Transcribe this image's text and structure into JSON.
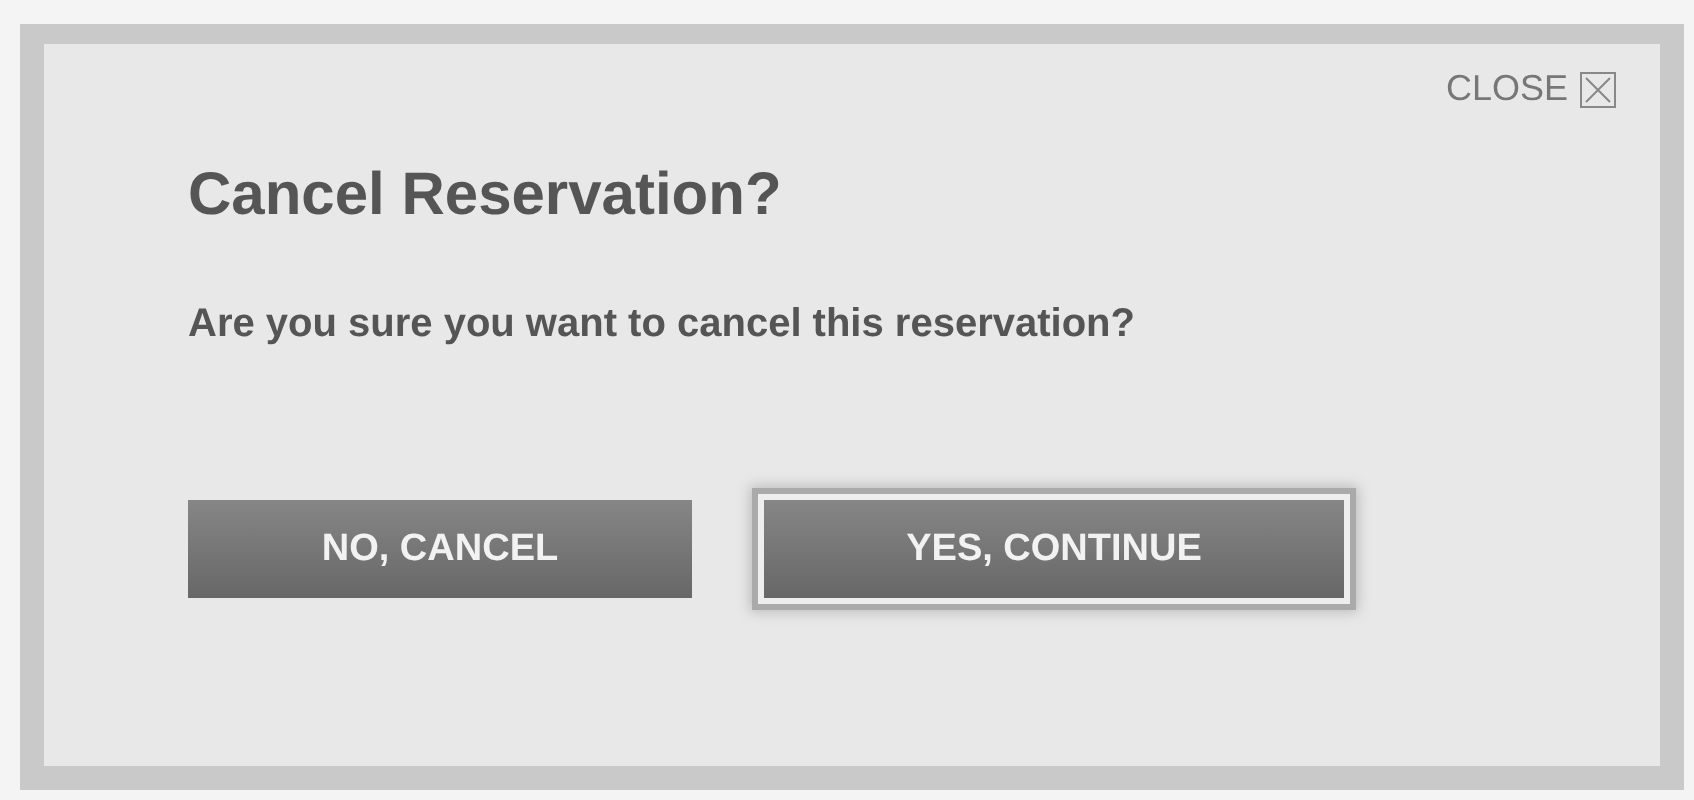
{
  "dialog": {
    "close_label": "CLOSE",
    "title": "Cancel Reservation?",
    "message": "Are you sure you want to cancel this reservation?",
    "buttons": [
      {
        "label": "NO, CANCEL",
        "focused": false
      },
      {
        "label": "YES, CONTINUE",
        "focused": true
      }
    ]
  }
}
